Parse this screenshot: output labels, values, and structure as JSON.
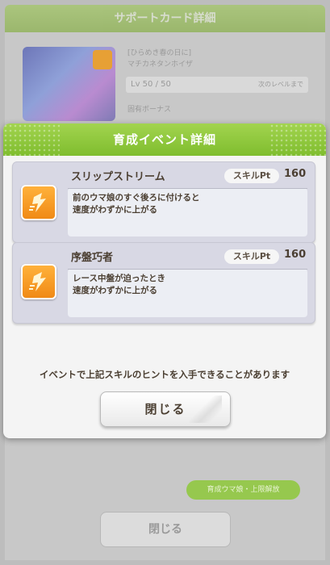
{
  "background": {
    "header_title": "サポートカード詳細",
    "card_line1": "[ひらめき春の日に]",
    "card_line2": "マチカネタンホイザ",
    "level_text": "Lv 50 / 50",
    "level_right": "次のレベルまで",
    "section_label": "固有ボーナス",
    "green_pill_label": "育成ウマ娘・上限解放",
    "close_label": "閉じる"
  },
  "modal": {
    "title": "育成イベント詳細",
    "skills": [
      {
        "name": "スリップストリーム",
        "pt_label": "スキルPt",
        "pt_value": "160",
        "desc_line1": "前のウマ娘のすぐ後ろに付けると",
        "desc_line2": "速度がわずかに上がる",
        "icon": "speed-skill-icon"
      },
      {
        "name": "序盤巧者",
        "pt_label": "スキルPt",
        "pt_value": "160",
        "desc_line1": "レース中盤が迫ったとき",
        "desc_line2": "速度がわずかに上がる",
        "icon": "speed-skill-icon"
      }
    ],
    "notice": "イベントで上記スキルのヒントを入手できることがあります",
    "close_label": "閉じる"
  }
}
